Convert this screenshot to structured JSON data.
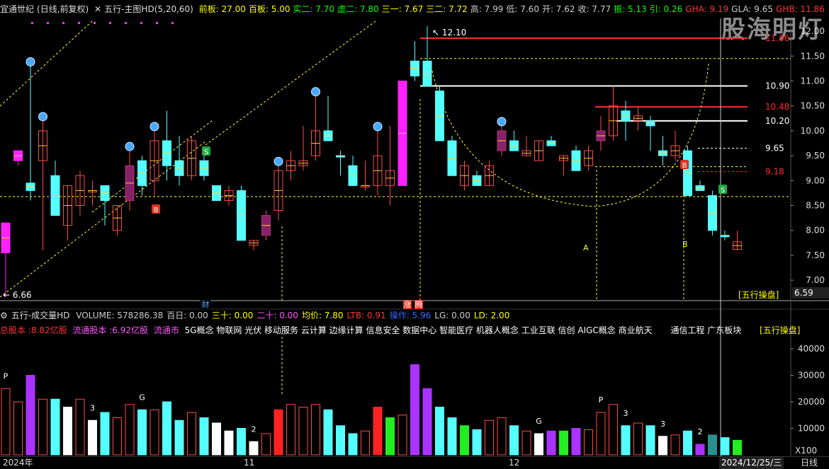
{
  "header": {
    "stock_name": "宜通世纪",
    "period_mode": "(日线,前复权)",
    "indicator_name": "五行-主图HD(5,20,60)",
    "quote_fields": [
      {
        "label": "前板:",
        "value": "27.00",
        "color": "#ffff00"
      },
      {
        "label": "百板:",
        "value": "5.00",
        "color": "#ffff00"
      },
      {
        "label": "实二:",
        "value": "7.70",
        "color": "#00ff00"
      },
      {
        "label": "虚二:",
        "value": "7.80",
        "color": "#00ff00"
      },
      {
        "label": "三一:",
        "value": "7.67",
        "color": "#ffff00"
      },
      {
        "label": "三二:",
        "value": "7.72",
        "color": "#ffff00"
      },
      {
        "label": "高:",
        "value": "7.99",
        "color": "#cccccc"
      },
      {
        "label": "低:",
        "value": "7.60",
        "color": "#cccccc"
      },
      {
        "label": "开:",
        "value": "7.62",
        "color": "#cccccc"
      },
      {
        "label": "收:",
        "value": "7.77",
        "color": "#cccccc"
      },
      {
        "label": "振:",
        "value": "5.13",
        "color": "#00ff00"
      },
      {
        "label": "引:",
        "value": "0.26",
        "color": "#00ff00"
      },
      {
        "label": "GHA:",
        "value": "9.19",
        "color": "#ff3333"
      },
      {
        "label": "GLA:",
        "value": "9.65",
        "color": "#cccccc"
      },
      {
        "label": "GHB:",
        "value": "11.86",
        "color": "#ff3333"
      }
    ]
  },
  "watermark": "股海明灯",
  "price_axis": [
    "12.00",
    "11.50",
    "11.00",
    "10.50",
    "10.00",
    "9.50",
    "9.00",
    "8.50",
    "8.00",
    "7.50",
    "7.00",
    "6.59"
  ],
  "price_labels": {
    "high_mark": "12.10",
    "low_mark": "6.66",
    "ghb": "11.86",
    "l1090": "10.90",
    "l1048": "10.48",
    "l1020": "10.20",
    "gla": "9.65",
    "gha": "9.18",
    "marker_a": "A",
    "marker_b_lower": "B",
    "bottom_caption": "[五行操盘]",
    "cai_label": "财",
    "zhang_label": "涨",
    "teng_label": "腾"
  },
  "volume_panel": {
    "title": "五行-成交量HD",
    "fields": [
      {
        "label": "VOLUME:",
        "value": "578286.38",
        "color": "#cccccc"
      },
      {
        "label": "百日:",
        "value": "0.00",
        "color": "#cccccc"
      },
      {
        "label": "三十:",
        "value": "0.00",
        "color": "#ffff00"
      },
      {
        "label": "二十:",
        "value": "0.00",
        "color": "#ff55ff"
      },
      {
        "label": "均价:",
        "value": "7.80",
        "color": "#ffff00"
      },
      {
        "label": "LTB:",
        "value": "0.91",
        "color": "#ff3333"
      },
      {
        "label": "操作:",
        "value": "5.96",
        "color": "#3366ff"
      },
      {
        "label": "LG:",
        "value": "0.00",
        "color": "#cccccc"
      },
      {
        "label": "LD:",
        "value": "2.00",
        "color": "#ffff00"
      }
    ],
    "total_shares": "总股本 :8.82亿股",
    "float_shares": "流通股本 :6.92亿股",
    "float_mv": "流通市",
    "concepts": "5G概念 物联网 光伏 移动服务 云计算 边缘计算 信息安全 数据中心 智能医疗 机器人概念 工业互联 信创 AIGC概念 商业航天",
    "region": "通信工程  广东板块",
    "caption": "[五行操盘]",
    "axis": [
      "40000",
      "30000",
      "20000",
      "10000",
      "X100"
    ]
  },
  "bottom": {
    "left_date": "2024年",
    "month_11": "11",
    "month_12": "12",
    "current_date": "2024/12/25/三",
    "period": "日线"
  },
  "chart_data": {
    "type": "candlestick",
    "y_range": [
      6.59,
      12.1
    ],
    "candles": [
      {
        "o": 7.55,
        "h": 8.15,
        "l": 6.66,
        "c": 8.15,
        "color": "magenta"
      },
      {
        "o": 9.6,
        "h": 9.6,
        "l": 9.3,
        "c": 9.4,
        "color": "magenta"
      },
      {
        "o": 8.8,
        "h": 11.3,
        "l": 8.6,
        "c": 8.95,
        "color": "cyan"
      },
      {
        "o": 9.4,
        "h": 10.2,
        "l": 7.6,
        "c": 10.0,
        "color": "red"
      },
      {
        "o": 8.3,
        "h": 9.4,
        "l": 8.3,
        "c": 9.1,
        "color": "cyan"
      },
      {
        "o": 8.1,
        "h": 8.9,
        "l": 7.8,
        "c": 8.9,
        "color": "red"
      },
      {
        "o": 8.5,
        "h": 9.2,
        "l": 8.3,
        "c": 9.1,
        "color": "red"
      },
      {
        "o": 8.8,
        "h": 9.0,
        "l": 8.5,
        "c": 8.8,
        "color": "red"
      },
      {
        "o": 8.9,
        "h": 8.9,
        "l": 8.1,
        "c": 8.6,
        "color": "cyan"
      },
      {
        "o": 8.0,
        "h": 8.5,
        "l": 7.9,
        "c": 8.5,
        "color": "red"
      },
      {
        "o": 8.6,
        "h": 9.6,
        "l": 8.4,
        "c": 9.3,
        "color": "magenta-fill"
      },
      {
        "o": 8.9,
        "h": 9.5,
        "l": 8.7,
        "c": 9.4,
        "color": "cyan"
      },
      {
        "o": 9.0,
        "h": 10.0,
        "l": 8.7,
        "c": 9.8,
        "color": "red"
      },
      {
        "o": 9.3,
        "h": 10.4,
        "l": 9.0,
        "c": 9.8,
        "color": "cyan"
      },
      {
        "o": 9.1,
        "h": 9.9,
        "l": 8.9,
        "c": 9.4,
        "color": "cyan"
      },
      {
        "o": 9.1,
        "h": 9.9,
        "l": 9.0,
        "c": 9.8,
        "color": "red"
      },
      {
        "o": 9.4,
        "h": 9.6,
        "l": 9.0,
        "c": 9.1,
        "color": "cyan"
      },
      {
        "o": 8.9,
        "h": 8.9,
        "l": 8.6,
        "c": 8.6,
        "color": "cyan"
      },
      {
        "o": 8.6,
        "h": 8.9,
        "l": 8.5,
        "c": 8.8,
        "color": "red"
      },
      {
        "o": 8.8,
        "h": 8.9,
        "l": 7.8,
        "c": 7.8,
        "color": "cyan"
      },
      {
        "o": 7.7,
        "h": 7.8,
        "l": 7.6,
        "c": 7.8,
        "color": "red"
      },
      {
        "o": 7.9,
        "h": 8.4,
        "l": 7.8,
        "c": 8.3,
        "color": "magenta-fill"
      },
      {
        "o": 8.4,
        "h": 9.3,
        "l": 8.2,
        "c": 9.2,
        "color": "red"
      },
      {
        "o": 9.2,
        "h": 9.6,
        "l": 9.0,
        "c": 9.4,
        "color": "red"
      },
      {
        "o": 9.3,
        "h": 10.1,
        "l": 9.2,
        "c": 9.4,
        "color": "red"
      },
      {
        "o": 9.5,
        "h": 10.7,
        "l": 9.4,
        "c": 10.0,
        "color": "red"
      },
      {
        "o": 10.0,
        "h": 10.7,
        "l": 9.8,
        "c": 9.8,
        "color": "cyan"
      },
      {
        "o": 9.5,
        "h": 9.6,
        "l": 9.1,
        "c": 9.5,
        "color": "cyan"
      },
      {
        "o": 9.3,
        "h": 9.5,
        "l": 8.9,
        "c": 8.9,
        "color": "cyan"
      },
      {
        "o": 8.9,
        "h": 9.4,
        "l": 8.8,
        "c": 8.9,
        "color": "red"
      },
      {
        "o": 8.9,
        "h": 10.0,
        "l": 8.7,
        "c": 9.5,
        "color": "red"
      },
      {
        "o": 8.9,
        "h": 10.1,
        "l": 8.5,
        "c": 9.2,
        "color": "red"
      },
      {
        "o": 8.9,
        "h": 11.0,
        "l": 8.9,
        "c": 11.0,
        "color": "magenta"
      },
      {
        "o": 11.4,
        "h": 11.8,
        "l": 11.0,
        "c": 11.1,
        "color": "cyan"
      },
      {
        "o": 11.4,
        "h": 12.1,
        "l": 10.9,
        "c": 10.9,
        "color": "cyan"
      },
      {
        "o": 10.8,
        "h": 10.9,
        "l": 9.8,
        "c": 9.8,
        "color": "cyan"
      },
      {
        "o": 9.8,
        "h": 9.9,
        "l": 9.1,
        "c": 9.1,
        "color": "cyan"
      },
      {
        "o": 8.9,
        "h": 9.4,
        "l": 8.8,
        "c": 9.3,
        "color": "red"
      },
      {
        "o": 9.1,
        "h": 9.2,
        "l": 8.9,
        "c": 8.9,
        "color": "cyan"
      },
      {
        "o": 8.9,
        "h": 9.4,
        "l": 8.9,
        "c": 9.3,
        "color": "red"
      },
      {
        "o": 9.6,
        "h": 10.1,
        "l": 9.5,
        "c": 10.0,
        "color": "magenta-fill"
      },
      {
        "o": 9.8,
        "h": 10.0,
        "l": 9.6,
        "c": 9.6,
        "color": "cyan"
      },
      {
        "o": 9.5,
        "h": 9.9,
        "l": 9.5,
        "c": 9.6,
        "color": "red"
      },
      {
        "o": 9.4,
        "h": 9.8,
        "l": 9.4,
        "c": 9.8,
        "color": "red"
      },
      {
        "o": 9.8,
        "h": 9.9,
        "l": 9.7,
        "c": 9.7,
        "color": "cyan"
      },
      {
        "o": 9.4,
        "h": 9.5,
        "l": 9.1,
        "c": 9.5,
        "color": "red"
      },
      {
        "o": 9.6,
        "h": 9.7,
        "l": 9.2,
        "c": 9.2,
        "color": "cyan"
      },
      {
        "o": 9.3,
        "h": 9.7,
        "l": 9.2,
        "c": 9.6,
        "color": "red"
      },
      {
        "o": 9.8,
        "h": 10.3,
        "l": 9.6,
        "c": 10.0,
        "color": "magenta-fill"
      },
      {
        "o": 9.9,
        "h": 10.9,
        "l": 9.8,
        "c": 10.5,
        "color": "red"
      },
      {
        "o": 10.4,
        "h": 10.6,
        "l": 9.8,
        "c": 10.2,
        "color": "cyan"
      },
      {
        "o": 10.2,
        "h": 10.5,
        "l": 10.0,
        "c": 10.3,
        "color": "red"
      },
      {
        "o": 10.2,
        "h": 10.3,
        "l": 9.6,
        "c": 10.1,
        "color": "cyan"
      },
      {
        "o": 9.6,
        "h": 9.9,
        "l": 9.3,
        "c": 9.5,
        "color": "cyan"
      },
      {
        "o": 9.5,
        "h": 10.0,
        "l": 9.4,
        "c": 9.7,
        "color": "red"
      },
      {
        "o": 9.6,
        "h": 9.7,
        "l": 8.7,
        "c": 8.7,
        "color": "cyan"
      },
      {
        "o": 8.9,
        "h": 9.0,
        "l": 8.8,
        "c": 8.8,
        "color": "cyan"
      },
      {
        "o": 8.7,
        "h": 8.8,
        "l": 7.9,
        "c": 8.0,
        "color": "cyan"
      },
      {
        "o": 7.9,
        "h": 8.0,
        "l": 7.8,
        "c": 7.9,
        "color": "cyan"
      },
      {
        "o": 7.62,
        "h": 7.99,
        "l": 7.6,
        "c": 7.77,
        "color": "red"
      }
    ],
    "volume": [
      {
        "v": 25000,
        "c": "red"
      },
      {
        "v": 20000,
        "c": "red"
      },
      {
        "v": 30000,
        "c": "purple"
      },
      {
        "v": 21000,
        "c": "red"
      },
      {
        "v": 21000,
        "c": "cyan"
      },
      {
        "v": 18000,
        "c": "white"
      },
      {
        "v": 21000,
        "c": "red"
      },
      {
        "v": 13000,
        "c": "white"
      },
      {
        "v": 16000,
        "c": "cyan"
      },
      {
        "v": 14000,
        "c": "red"
      },
      {
        "v": 19000,
        "c": "red"
      },
      {
        "v": 17000,
        "c": "cyan"
      },
      {
        "v": 17000,
        "c": "red"
      },
      {
        "v": 20000,
        "c": "cyan"
      },
      {
        "v": 13000,
        "c": "cyan"
      },
      {
        "v": 16000,
        "c": "red"
      },
      {
        "v": 14000,
        "c": "cyan"
      },
      {
        "v": 12000,
        "c": "white"
      },
      {
        "v": 9000,
        "c": "white"
      },
      {
        "v": 10000,
        "c": "cyan"
      },
      {
        "v": 5000,
        "c": "white"
      },
      {
        "v": 8000,
        "c": "red"
      },
      {
        "v": 17000,
        "c": "redfill"
      },
      {
        "v": 19000,
        "c": "red"
      },
      {
        "v": 18000,
        "c": "red"
      },
      {
        "v": 19000,
        "c": "red"
      },
      {
        "v": 17000,
        "c": "cyan"
      },
      {
        "v": 11000,
        "c": "cyan"
      },
      {
        "v": 8000,
        "c": "cyan"
      },
      {
        "v": 9000,
        "c": "red"
      },
      {
        "v": 18000,
        "c": "redfill"
      },
      {
        "v": 14000,
        "c": "green"
      },
      {
        "v": 15000,
        "c": "red"
      },
      {
        "v": 34000,
        "c": "purple"
      },
      {
        "v": 25000,
        "c": "purple"
      },
      {
        "v": 18000,
        "c": "cyan"
      },
      {
        "v": 14000,
        "c": "cyan"
      },
      {
        "v": 11000,
        "c": "green"
      },
      {
        "v": 9500,
        "c": "cyan"
      },
      {
        "v": 13000,
        "c": "red"
      },
      {
        "v": 14000,
        "c": "red"
      },
      {
        "v": 11000,
        "c": "cyan"
      },
      {
        "v": 9000,
        "c": "red"
      },
      {
        "v": 8000,
        "c": "white"
      },
      {
        "v": 9000,
        "c": "purple"
      },
      {
        "v": 9000,
        "c": "green"
      },
      {
        "v": 10000,
        "c": "purple"
      },
      {
        "v": 9500,
        "c": "red"
      },
      {
        "v": 16000,
        "c": "red"
      },
      {
        "v": 19000,
        "c": "red"
      },
      {
        "v": 11000,
        "c": "cyan"
      },
      {
        "v": 12000,
        "c": "red"
      },
      {
        "v": 11000,
        "c": "cyan"
      },
      {
        "v": 7000,
        "c": "white"
      },
      {
        "v": 7500,
        "c": "red"
      },
      {
        "v": 9000,
        "c": "cyan"
      },
      {
        "v": 4000,
        "c": "purple"
      },
      {
        "v": 7500,
        "c": "teal"
      },
      {
        "v": 6500,
        "c": "cyan"
      },
      {
        "v": 5500,
        "c": "green"
      }
    ],
    "volume_labels": [
      {
        "i": 0,
        "t": "P"
      },
      {
        "i": 11,
        "t": "G"
      },
      {
        "i": 7,
        "t": "3"
      },
      {
        "i": 20,
        "t": "2"
      },
      {
        "i": 43,
        "t": "G"
      },
      {
        "i": 48,
        "t": "P"
      },
      {
        "i": 50,
        "t": "3"
      },
      {
        "i": 53,
        "t": "3"
      },
      {
        "i": 56,
        "t": "2"
      }
    ],
    "levels": [
      {
        "y": 11.86,
        "color": "#ff2a2a",
        "style": "solid"
      },
      {
        "y": 11.45,
        "color": "#ffff33",
        "style": "dashed"
      },
      {
        "y": 10.9,
        "color": "#ffffff",
        "style": "solid"
      },
      {
        "y": 10.48,
        "color": "#ff2a2a",
        "style": "solid"
      },
      {
        "y": 10.2,
        "color": "#ffffff",
        "style": "solid"
      },
      {
        "y": 9.65,
        "color": "#ffffff",
        "style": "dashed"
      },
      {
        "y": 9.28,
        "color": "#ffff33",
        "style": "dashed"
      },
      {
        "y": 9.18,
        "color": "#ff2a2a",
        "style": "dashed"
      },
      {
        "y": 8.68,
        "color": "#ffff33",
        "style": "dashed"
      }
    ]
  }
}
